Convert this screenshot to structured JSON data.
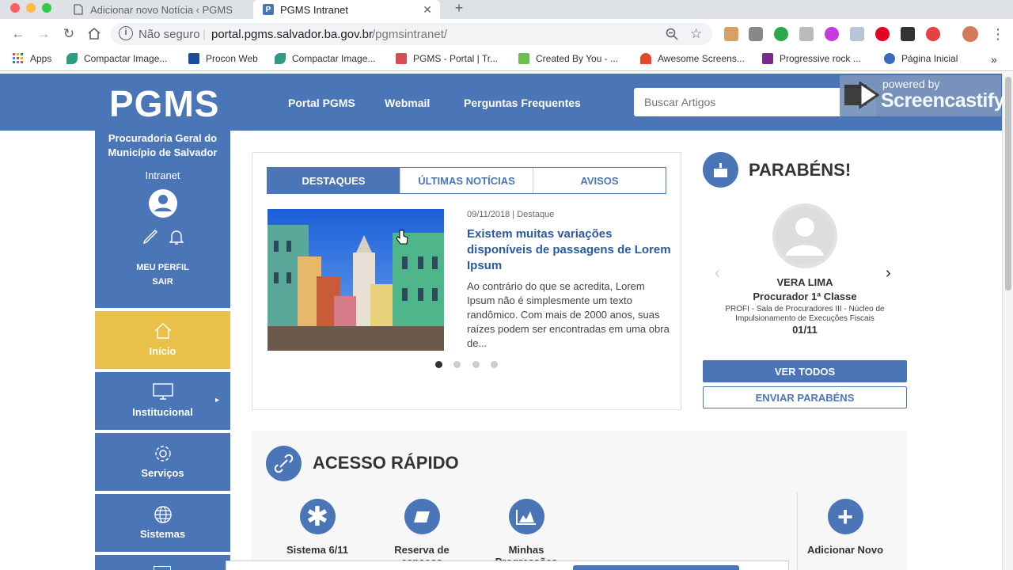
{
  "browser": {
    "tabs": [
      {
        "title": "Adicionar novo Notícia ‹ PGMS"
      },
      {
        "title": "PGMS Intranet"
      }
    ],
    "url_prefix": "Não seguro",
    "url_host": "portal.pgms.salvador.ba.gov.br",
    "url_path": "/pgmsintranet/",
    "bookmarks": [
      {
        "label": "Apps",
        "color": "#e8453c"
      },
      {
        "label": "Compactar Image...",
        "color": "#2f9b82"
      },
      {
        "label": "Procon Web",
        "color": "#1e4aa0"
      },
      {
        "label": "Compactar Image...",
        "color": "#2f9b82"
      },
      {
        "label": "PGMS - Portal | Tr...",
        "color": "#d84b56"
      },
      {
        "label": "Created By You - ...",
        "color": "#6cbf4b"
      },
      {
        "label": "Awesome Screens...",
        "color": "#e04a2a"
      },
      {
        "label": "Progressive rock ...",
        "color": "#7a2a8a"
      },
      {
        "label": "Página Inicial",
        "color": "#3a6ac0"
      }
    ],
    "more_bookmarks": "»"
  },
  "header": {
    "logo": "PGMS",
    "nav": [
      "Portal PGMS",
      "Webmail",
      "Perguntas Frequentes"
    ],
    "search_placeholder": "Buscar Artigos",
    "badge_top": "powered by",
    "badge_brand": "Screencastify"
  },
  "sidebar": {
    "org": "Procuradoria Geral do Município de Salvador",
    "subtitle": "Intranet",
    "profile": "MEU PERFIL",
    "logout": "SAIR",
    "items": [
      {
        "label": "Início",
        "icon": "home-icon"
      },
      {
        "label": "Institucional",
        "icon": "monitor-icon"
      },
      {
        "label": "Serviços",
        "icon": "gear-icon"
      },
      {
        "label": "Sistemas",
        "icon": "globe-icon"
      }
    ]
  },
  "news": {
    "tabs": [
      "DESTAQUES",
      "ÚLTIMAS NOTÍCIAS",
      "AVISOS"
    ],
    "meta": "09/11/2018 | Destaque",
    "title": "Existem muitas variações disponíveis de passagens de Lorem Ipsum",
    "body": "Ao contrário do que se acredita, Lorem Ipsum não é simplesmente um texto randômico. Com mais de 2000 anos, suas raízes podem ser encontradas em uma obra de..."
  },
  "birthday": {
    "title": "PARABÉNS!",
    "name": "VERA LIMA",
    "role": "Procurador 1ª Classe",
    "desc": "PROFI - Sala de Procuradores III - Núcleo de Impulsionamento de Execuções Fiscais",
    "date": "01/11",
    "btn_all": "VER TODOS",
    "btn_send": "ENVIAR PARABÉNS"
  },
  "quick": {
    "title": "ACESSO RÁPIDO",
    "items": [
      {
        "label": "Sistema 6/11",
        "icon": "asterisk-icon"
      },
      {
        "label": "Reserva de espaços",
        "icon": "ticket-icon"
      },
      {
        "label": "Minhas Progressões",
        "icon": "chart-icon"
      }
    ],
    "add_label": "Adicionar Novo"
  },
  "colors": {
    "primary": "#4a76b8",
    "accent": "#e9c04a"
  }
}
